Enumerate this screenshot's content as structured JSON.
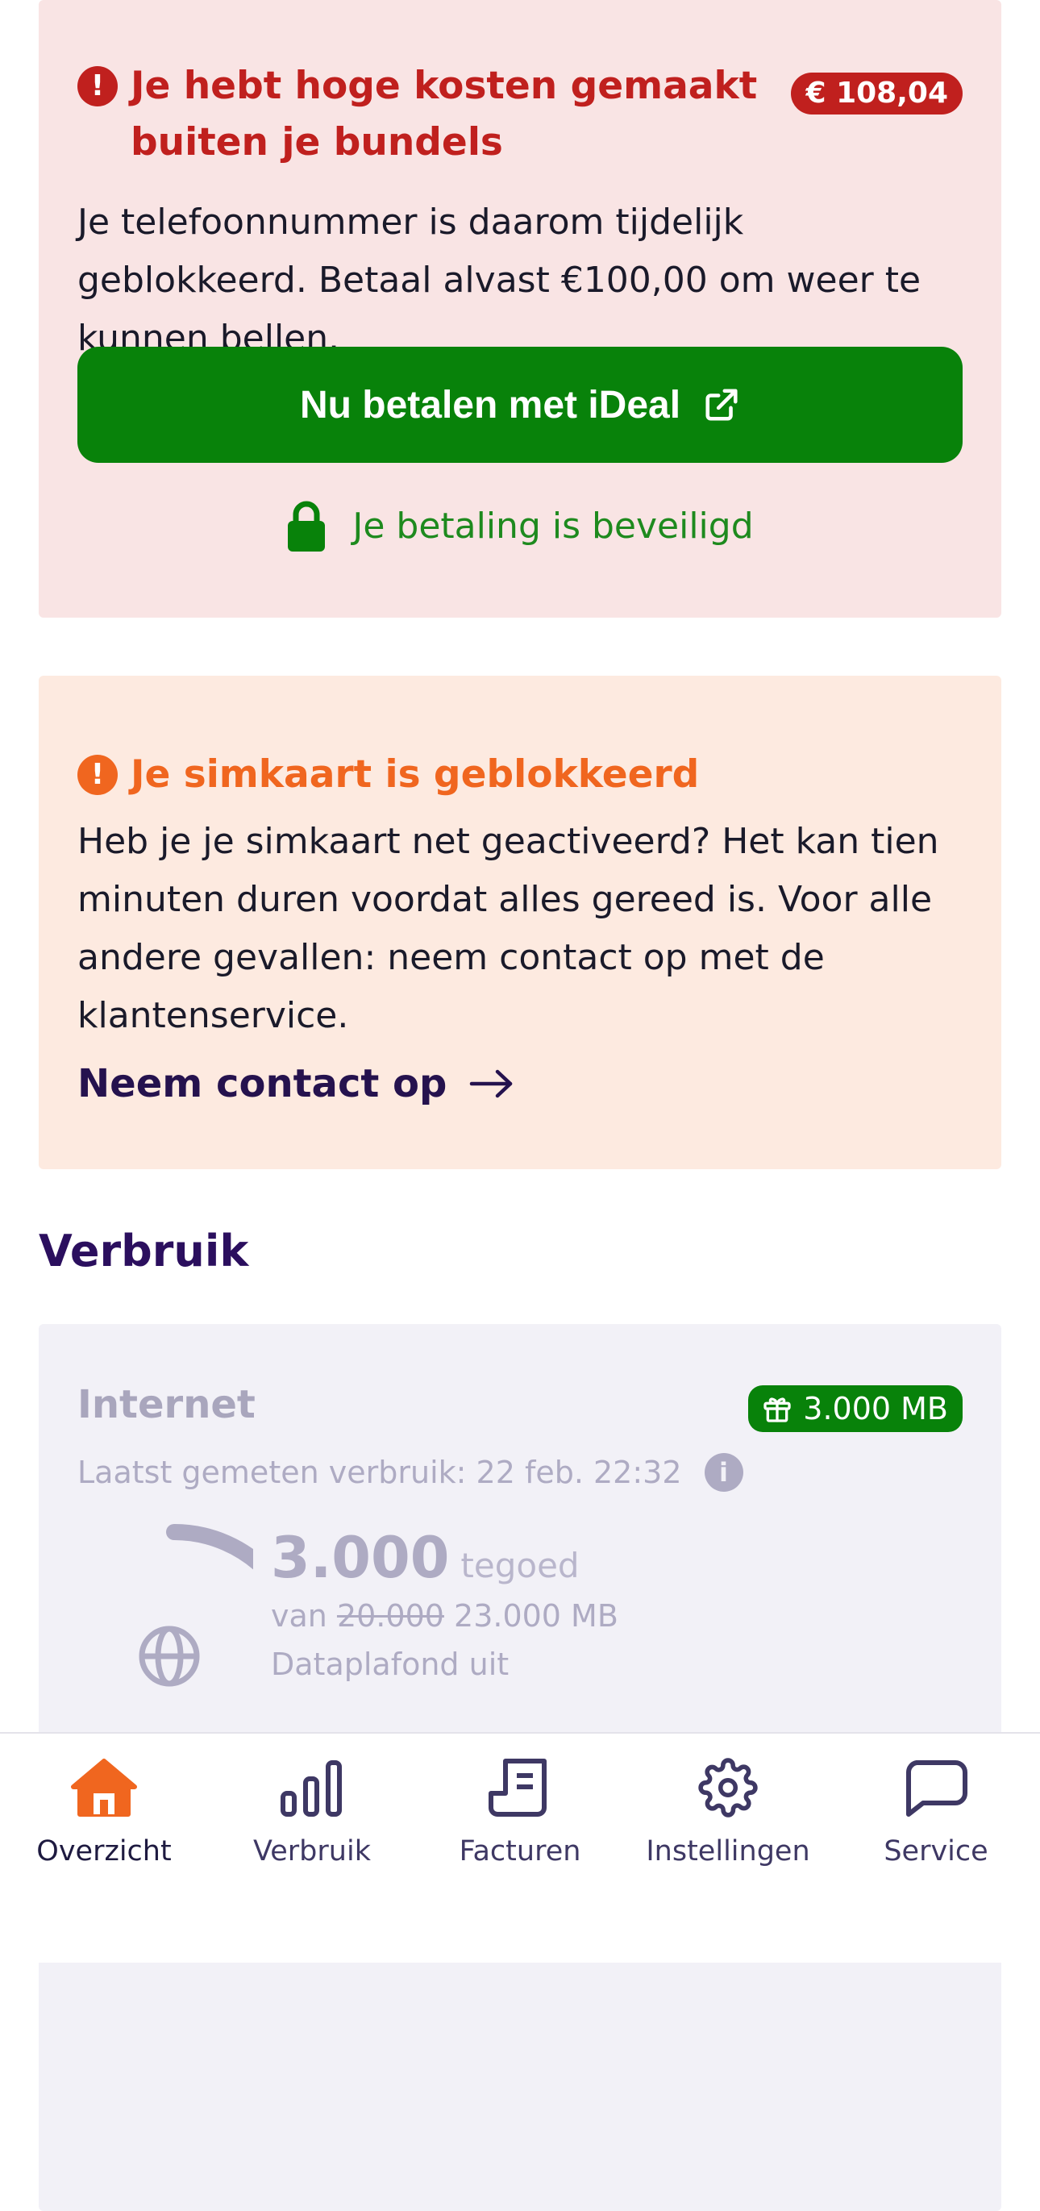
{
  "alerts": {
    "high_costs": {
      "title": "Je hebt hoge kosten gemaakt buiten je bundels",
      "amount": "€ 108,04",
      "body": "Je telefoonnummer is daarom tijdelijk geblokkeerd. Betaal alvast €100,00 om weer te kunnen bellen.",
      "pay_button": "Nu betalen met iDeal",
      "secure_note": "Je betaling is beveiligd",
      "icon": "exclamation-icon",
      "color": "#c0201e"
    },
    "sim_blocked": {
      "title": "Je simkaart is geblokkeerd",
      "body": "Heb je je simkaart net geactiveerd? Het kan tien minuten duren voordat alles gereed is. Voor alle andere gevallen: neem contact op met de klantenservice.",
      "link": "Neem contact op",
      "icon": "exclamation-icon",
      "color": "#f0661f"
    }
  },
  "usage": {
    "section_title": "Verbruik",
    "internet": {
      "title": "Internet",
      "bonus": "3.000 MB",
      "last_measured": "Laatst gemeten verbruik: 22 feb. 22:32",
      "remaining": "3.000",
      "remaining_label": "tegoed",
      "of_label": "van",
      "old_total": "20.000",
      "new_total": "23.000 MB",
      "cap_status": "Dataplafond uit",
      "remaining_fraction": 0.13
    }
  },
  "nav": {
    "items": [
      {
        "label": "Overzicht",
        "icon": "home-icon",
        "active": true
      },
      {
        "label": "Verbruik",
        "icon": "bar-chart-icon",
        "active": false
      },
      {
        "label": "Facturen",
        "icon": "invoice-icon",
        "active": false
      },
      {
        "label": "Instellingen",
        "icon": "gear-icon",
        "active": false
      },
      {
        "label": "Service",
        "icon": "chat-bubble-icon",
        "active": false
      }
    ],
    "active_color": "#f0661f",
    "icon_color": "#3e3864"
  },
  "colors": {
    "primary_green": "#08820a",
    "brand_purple": "#2b0f5e"
  }
}
